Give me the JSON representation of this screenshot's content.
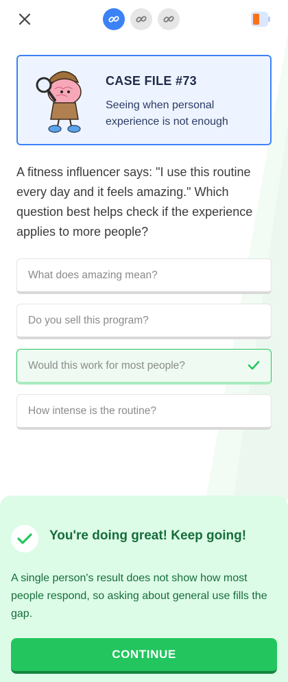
{
  "header": {
    "close_icon": "close-icon",
    "steps": [
      {
        "icon": "link-icon",
        "state": "active"
      },
      {
        "icon": "link-icon",
        "state": "inactive"
      },
      {
        "icon": "link-icon",
        "state": "inactive"
      }
    ],
    "battery_icon": "battery-low-icon"
  },
  "case": {
    "title": "CASE FILE #73",
    "subtitle": "Seeing when personal experience is not enough",
    "illustration": "detective-brain-illustration"
  },
  "question": {
    "text": "A fitness influencer says: \"I use this routine every day and it feels amazing.\" Which question best helps check if the experience applies to more people?"
  },
  "options": [
    {
      "label": "What does amazing mean?",
      "state": "default"
    },
    {
      "label": "Do you sell this program?",
      "state": "default"
    },
    {
      "label": "Would this work for most people?",
      "state": "correct"
    },
    {
      "label": "How intense is the routine?",
      "state": "default"
    }
  ],
  "feedback": {
    "title": "You're doing great! Keep going!",
    "text": "A single person's result does not show how most people respond, so asking about general use fills the gap.",
    "continue_label": "CONTINUE"
  },
  "colors": {
    "accent_blue": "#3b82f6",
    "success_green": "#22c55e",
    "success_text": "#176c3a",
    "feedback_bg": "#dcfce7",
    "battery_orange": "#f97316"
  }
}
